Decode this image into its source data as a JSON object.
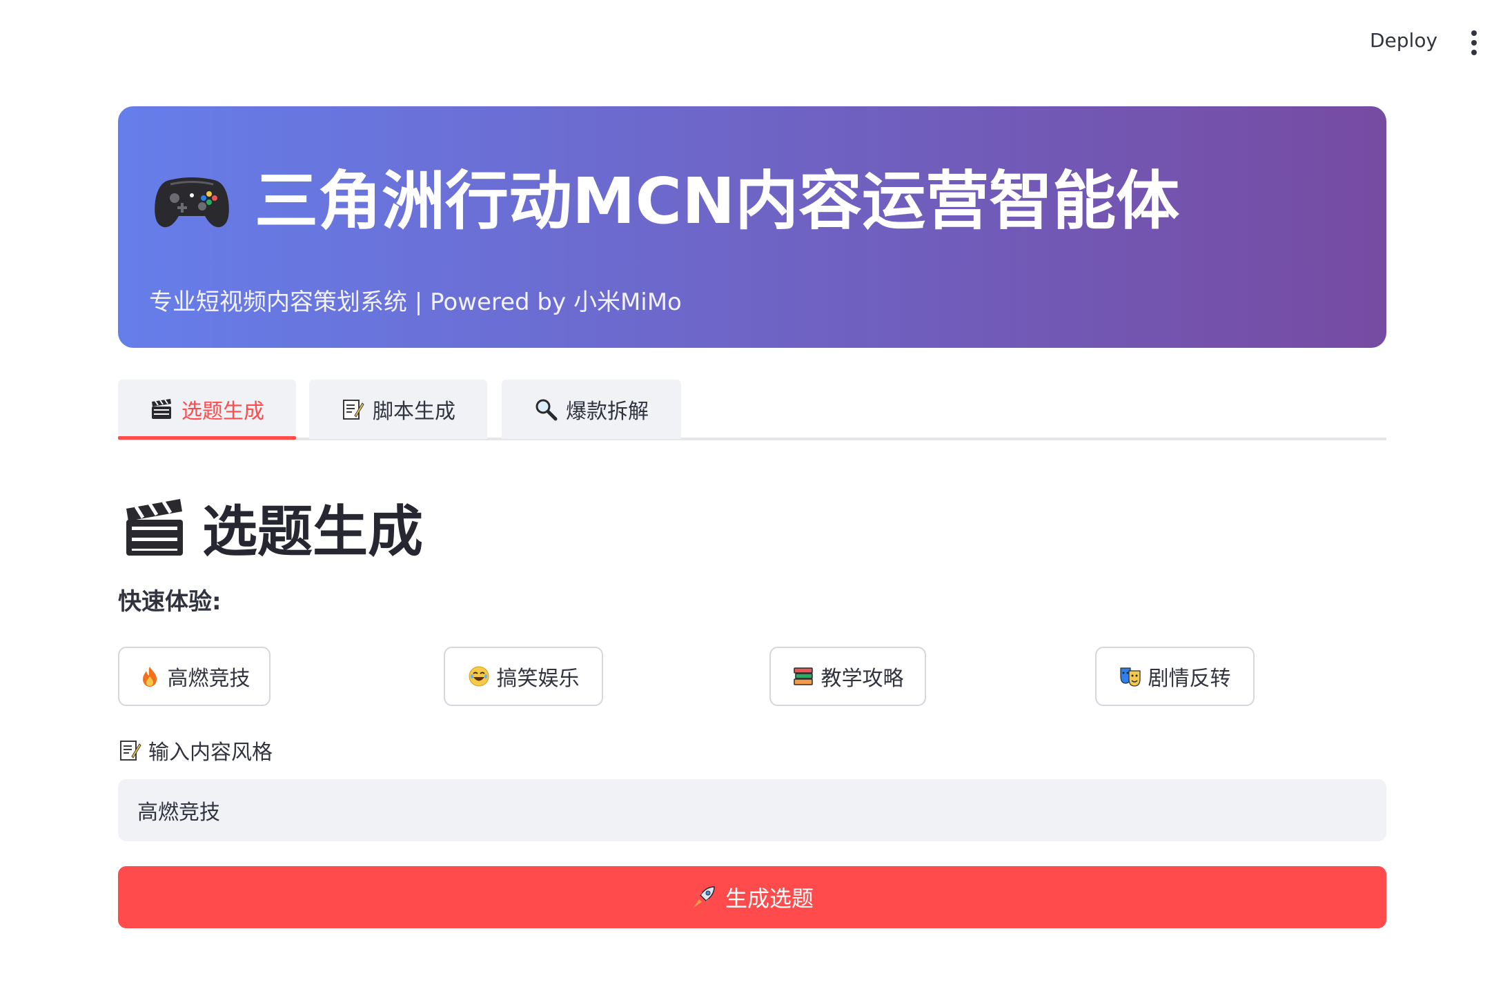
{
  "topbar": {
    "deploy_label": "Deploy",
    "menu_icon": "kebab-menu-icon"
  },
  "hero": {
    "icon": "gamepad-icon",
    "title": "三角洲行动MCN内容运营智能体",
    "subtitle": "专业短视频内容策划系统 | Powered by 小米MiMo",
    "gradient_start": "#667eea",
    "gradient_end": "#764ba2"
  },
  "tabs": [
    {
      "label": "选题生成",
      "icon": "clapperboard-icon",
      "active": true
    },
    {
      "label": "脚本生成",
      "icon": "memo-icon",
      "active": false
    },
    {
      "label": "爆款拆解",
      "icon": "magnifier-icon",
      "active": false
    }
  ],
  "section": {
    "icon": "clapperboard-icon",
    "title": "选题生成",
    "quick_label": "快速体验:"
  },
  "quick_buttons": [
    {
      "label": "高燃竞技",
      "icon": "fire-icon"
    },
    {
      "label": "搞笑娱乐",
      "icon": "laughing-face-icon"
    },
    {
      "label": "教学攻略",
      "icon": "books-icon"
    },
    {
      "label": "剧情反转",
      "icon": "theater-masks-icon"
    }
  ],
  "input": {
    "label": "输入内容风格",
    "icon": "memo-icon",
    "value": "高燃竞技"
  },
  "primary_button": {
    "label": "生成选题",
    "icon": "rocket-icon"
  },
  "colors": {
    "accent": "#ff4b4b",
    "input_bg": "#f0f2f6",
    "text": "#31333f"
  }
}
